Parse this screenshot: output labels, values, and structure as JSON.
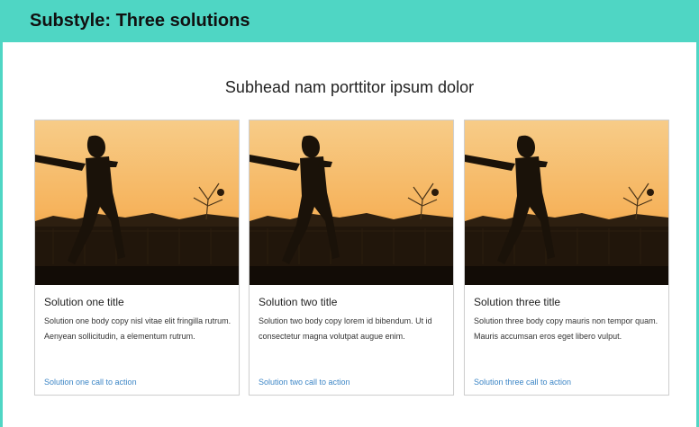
{
  "header": {
    "title": "Substyle: Three solutions"
  },
  "subhead": "Subhead nam porttitor ipsum dolor",
  "cards": [
    {
      "title": "Solution one title",
      "body": "Solution one body copy nisl vitae elit fringilla rutrum. Aenyean sollicitudin, a elementum rutrum.",
      "cta": "Solution one call to action"
    },
    {
      "title": "Solution two title",
      "body": "Solution two body copy lorem id bibendum. Ut id consectetur magna volutpat augue enim.",
      "cta": "Solution two call to action"
    },
    {
      "title": "Solution three title",
      "body": "Solution three body copy mauris non tempor quam. Mauris accumsan eros eget libero vulput.",
      "cta": "Solution three call to action"
    }
  ],
  "colors": {
    "accent": "#4fd6c4",
    "link": "#3d86c6"
  }
}
